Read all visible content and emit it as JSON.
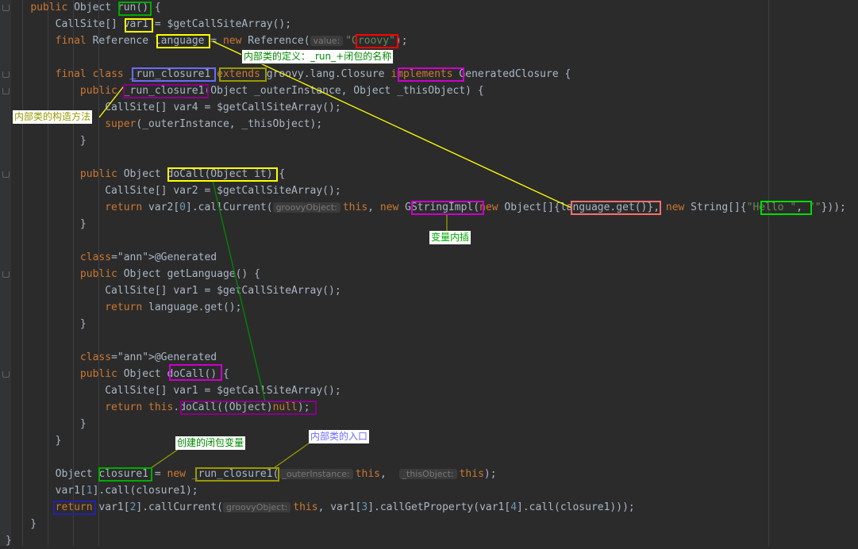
{
  "editor": {
    "lines": [
      "    public Object run() {",
      "        CallSite[] var1 = $getCallSiteArray();",
      "        final Reference language = new Reference(",
      "",
      "        final class _run_closure1 extends groovy.lang.Closure implements GeneratedClosure {",
      "            public _run_closure1(Object _outerInstance, Object _thisObject) {",
      "                CallSite[] var4 = $getCallSiteArray();",
      "                super(_outerInstance, _thisObject);",
      "            }",
      "",
      "            public Object doCall(Object it) {",
      "                CallSite[] var2 = $getCallSiteArray();",
      "                return var2[0].callCurrent(",
      "            }",
      "",
      "            @Generated",
      "            public Object getLanguage() {",
      "                CallSite[] var1 = $getCallSiteArray();",
      "                return language.get();",
      "            }",
      "",
      "            @Generated",
      "            public Object doCall() {",
      "                CallSite[] var1 = $getCallSiteArray();",
      "                return this.doCall((Object)null);",
      "            }",
      "        }",
      "",
      "        Object closure1 = new _run_closure1(",
      "        var1[1].call(closure1);",
      "        return var1[2].callCurrent(",
      "    }",
      "}"
    ],
    "hints": {
      "value": "value:",
      "groovyObject": "groovyObject:",
      "outerInstance": "_outerInstance:",
      "thisObject": "_thisObject:"
    },
    "tokens": {
      "groovy_str": "\"Groovy\"",
      "hello_str": "\"Hello \"",
      "empty_str": "\"\""
    }
  },
  "annotations": {
    "inner_class_def": "内部类的定义：_run_+闭包的名称",
    "constructor": "内部类的构造方法",
    "interpolation": "变量内插",
    "closure_var": "创建的闭包变量",
    "entry": "内部类的入口"
  },
  "colors": {
    "yellow": "#ffff00",
    "red": "#ff0000",
    "green": "#00cc00",
    "magenta": "#cc00cc",
    "blue": "#4b4bff",
    "dark_green": "#008800",
    "olive": "#999900"
  }
}
